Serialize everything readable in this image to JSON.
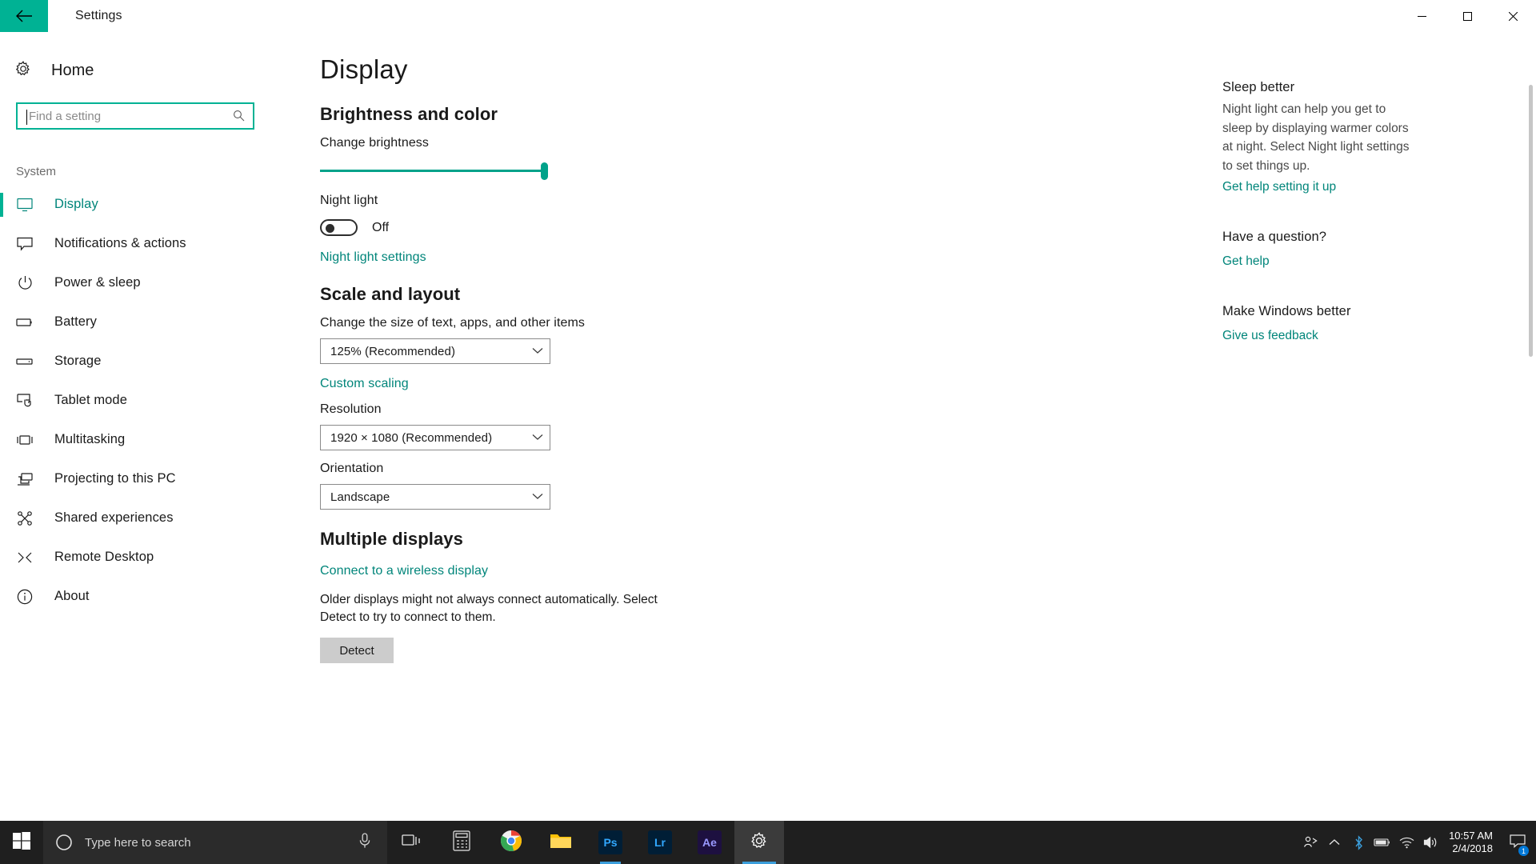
{
  "window": {
    "title": "Settings",
    "back_icon": "arrow-left-icon",
    "minimize_label": "—",
    "maximize_label": "☐",
    "close_label": "✕",
    "accent_color": "#00B294",
    "accent_text_color": "#00857a"
  },
  "sidebar": {
    "home_label": "Home",
    "home_icon": "gear-icon",
    "search": {
      "placeholder": "Find a setting",
      "value": "",
      "icon": "search-icon"
    },
    "group_title": "System",
    "items": [
      {
        "label": "Display",
        "icon": "monitor-icon",
        "active": true
      },
      {
        "label": "Notifications & actions",
        "icon": "speech-bubble-icon",
        "active": false
      },
      {
        "label": "Power & sleep",
        "icon": "power-icon",
        "active": false
      },
      {
        "label": "Battery",
        "icon": "battery-icon",
        "active": false
      },
      {
        "label": "Storage",
        "icon": "storage-icon",
        "active": false
      },
      {
        "label": "Tablet mode",
        "icon": "tablet-touch-icon",
        "active": false
      },
      {
        "label": "Multitasking",
        "icon": "multitasking-icon",
        "active": false
      },
      {
        "label": "Projecting to this PC",
        "icon": "projecting-icon",
        "active": false
      },
      {
        "label": "Shared experiences",
        "icon": "share-nodes-icon",
        "active": false
      },
      {
        "label": "Remote Desktop",
        "icon": "remote-desktop-icon",
        "active": false
      },
      {
        "label": "About",
        "icon": "info-icon",
        "active": false
      }
    ]
  },
  "main": {
    "page_title": "Display",
    "brightness_section": {
      "heading": "Brightness and color",
      "brightness_label": "Change brightness",
      "brightness_value": 100,
      "night_light_label": "Night light",
      "night_light_state": "Off",
      "night_light_on": false,
      "night_light_settings_link": "Night light settings"
    },
    "scale_section": {
      "heading": "Scale and layout",
      "scale_label": "Change the size of text, apps, and other items",
      "scale_value": "125% (Recommended)",
      "custom_scaling_link": "Custom scaling",
      "resolution_label": "Resolution",
      "resolution_value": "1920 × 1080 (Recommended)",
      "orientation_label": "Orientation",
      "orientation_value": "Landscape",
      "chevron_icon": "chevron-down-icon"
    },
    "multiple_displays_section": {
      "heading": "Multiple displays",
      "wireless_link": "Connect to a wireless display",
      "description": "Older displays might not always connect automatically. Select Detect to try to connect to them.",
      "detect_button": "Detect"
    }
  },
  "aside": {
    "blocks": [
      {
        "heading": "Sleep better",
        "text": "Night light can help you get to sleep by displaying warmer colors at night. Select Night light settings to set things up.",
        "link": "Get help setting it up"
      },
      {
        "heading": "Have a question?",
        "text": "",
        "link": "Get help"
      },
      {
        "heading": "Make Windows better",
        "text": "",
        "link": "Give us feedback"
      }
    ]
  },
  "taskbar": {
    "start_icon": "windows-logo-icon",
    "search": {
      "placeholder": "Type here to search",
      "icon": "cortana-circle-icon",
      "mic_icon": "microphone-icon"
    },
    "apps": [
      {
        "name": "task-view",
        "label": "",
        "icon": "task-view-icon",
        "color": "transparent",
        "state": "none"
      },
      {
        "name": "calculator",
        "label": "",
        "icon": "calculator-icon",
        "color": "transparent",
        "state": "none"
      },
      {
        "name": "google-chrome",
        "label": "",
        "icon": "chrome-icon",
        "color": "transparent",
        "state": "none"
      },
      {
        "name": "file-explorer",
        "label": "",
        "icon": "folder-icon",
        "color": "transparent",
        "state": "none"
      },
      {
        "name": "adobe-photoshop",
        "label": "Ps",
        "icon": "photoshop-icon",
        "color": "#001E36",
        "state": "running"
      },
      {
        "name": "adobe-lightroom",
        "label": "Lr",
        "icon": "lightroom-icon",
        "color": "#001E36",
        "state": "none"
      },
      {
        "name": "adobe-after-effects",
        "label": "Ae",
        "icon": "after-effects-icon",
        "color": "#1D1040",
        "state": "none"
      },
      {
        "name": "settings",
        "label": "",
        "icon": "gear-icon",
        "color": "transparent",
        "state": "active"
      }
    ],
    "tray": [
      {
        "name": "meet-now",
        "icon": "people-icon"
      },
      {
        "name": "show-hidden-icons",
        "icon": "chevron-up-icon"
      },
      {
        "name": "bluetooth",
        "icon": "bluetooth-icon"
      },
      {
        "name": "battery",
        "icon": "battery-icon"
      },
      {
        "name": "network",
        "icon": "wifi-icon"
      },
      {
        "name": "volume",
        "icon": "speaker-icon"
      }
    ],
    "clock": {
      "time": "10:57 AM",
      "date": "2/4/2018"
    },
    "notifications": {
      "icon": "notification-icon",
      "count": "1"
    }
  }
}
